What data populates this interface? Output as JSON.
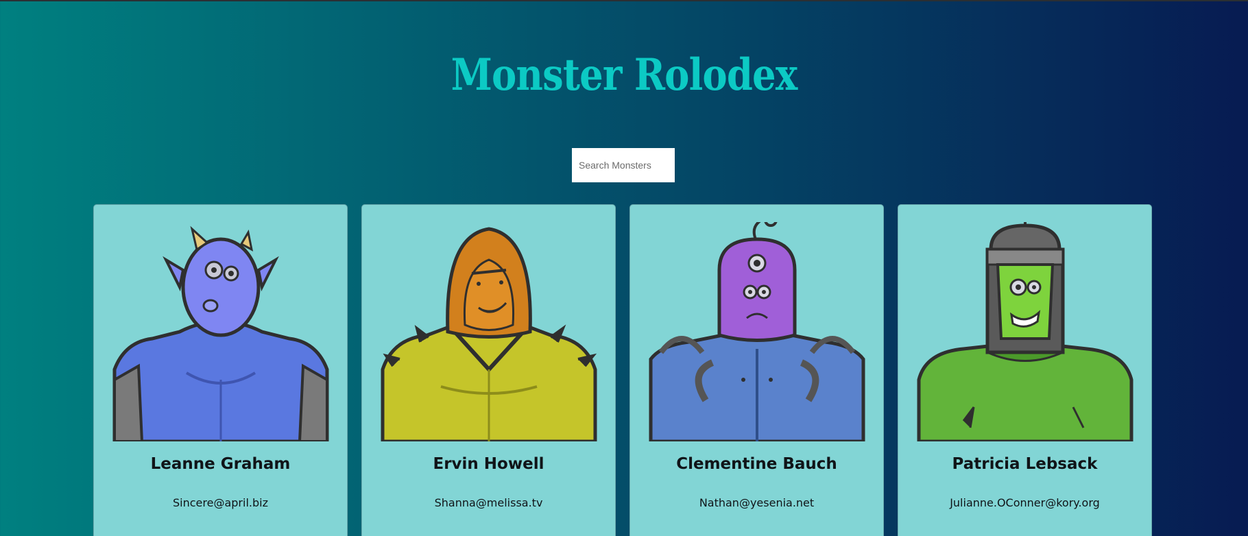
{
  "app": {
    "title": "Monster Rolodex"
  },
  "search": {
    "placeholder": "Search Monsters"
  },
  "colors": {
    "title": "#0ccac4",
    "card_bg": "#82d5d5",
    "gradient_start": "#008080",
    "gradient_end": "#071b52"
  },
  "monsters": [
    {
      "name": "Leanne Graham",
      "email": "Sincere@april.biz",
      "image_icon": "blue-horned-monster-icon"
    },
    {
      "name": "Ervin Howell",
      "email": "Shanna@melissa.tv",
      "image_icon": "orange-hooded-monster-icon"
    },
    {
      "name": "Clementine Bauch",
      "email": "Nathan@yesenia.net",
      "image_icon": "purple-three-eyed-monster-icon"
    },
    {
      "name": "Patricia Lebsack",
      "email": "Julianne.OConner@kory.org",
      "image_icon": "green-robot-monster-icon"
    }
  ]
}
